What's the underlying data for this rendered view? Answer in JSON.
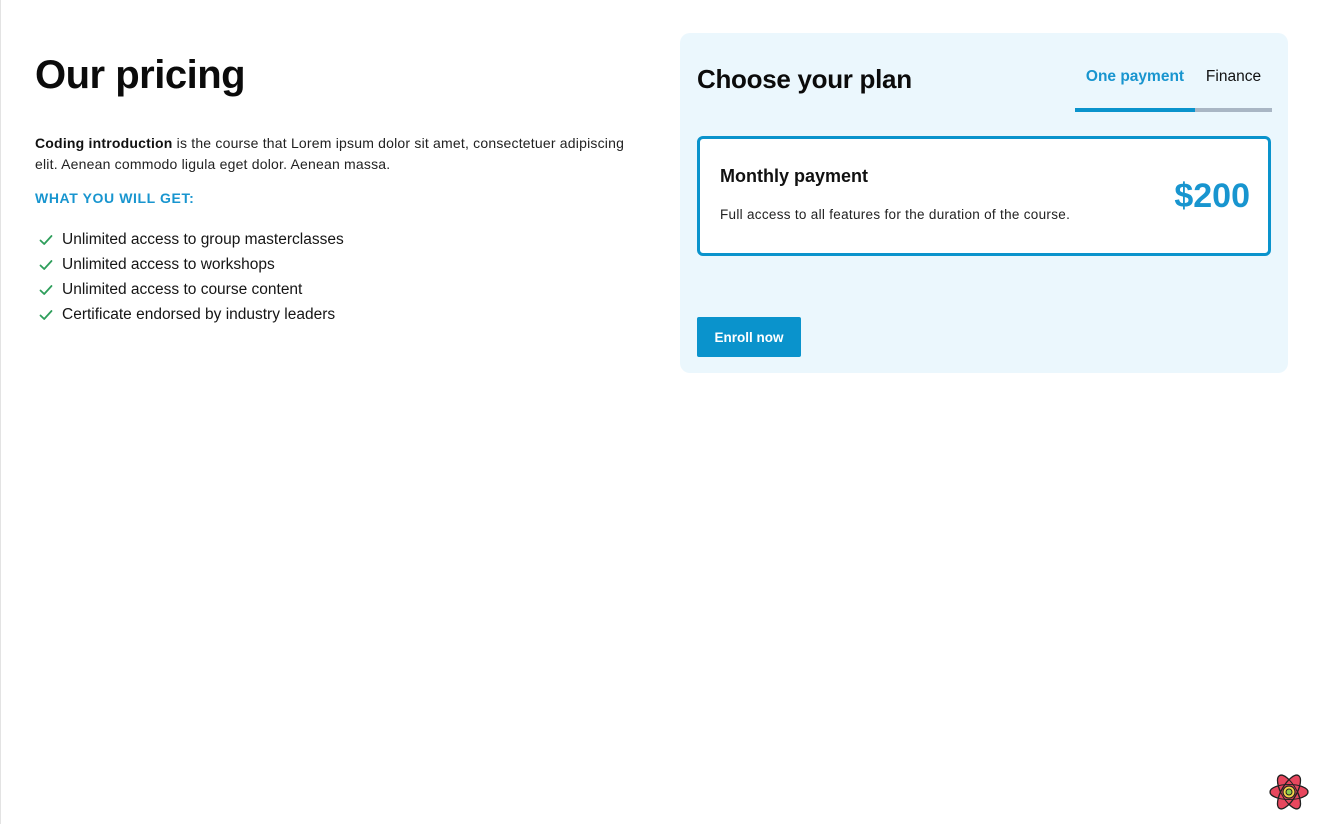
{
  "left": {
    "title": "Our pricing",
    "description_bold": "Coding introduction",
    "description_rest": " is the course that Lorem ipsum dolor sit amet, consectetuer adipiscing elit. Aenean commodo ligula eget dolor. Aenean massa.",
    "features_heading": "WHAT YOU WILL GET:",
    "features": [
      "Unlimited access to group masterclasses",
      "Unlimited access to workshops",
      "Unlimited access to course content",
      "Certificate endorsed by industry leaders"
    ],
    "feature_icon": "check-icon"
  },
  "plan": {
    "title": "Choose your plan",
    "tabs": [
      {
        "label": "One payment",
        "active": true
      },
      {
        "label": "Finance",
        "active": false
      }
    ],
    "option": {
      "name": "Monthly payment",
      "description": "Full access to all features for the duration of the course.",
      "price": "$200"
    },
    "enroll_label": "Enroll now"
  },
  "colors": {
    "accent": "#0a93cc",
    "accent_text": "#1895cf",
    "card_bg": "#ebf7fd",
    "check": "#2e9e5b",
    "tab_track": "#a9b6c4"
  },
  "corner_icon": "react-logo-icon"
}
